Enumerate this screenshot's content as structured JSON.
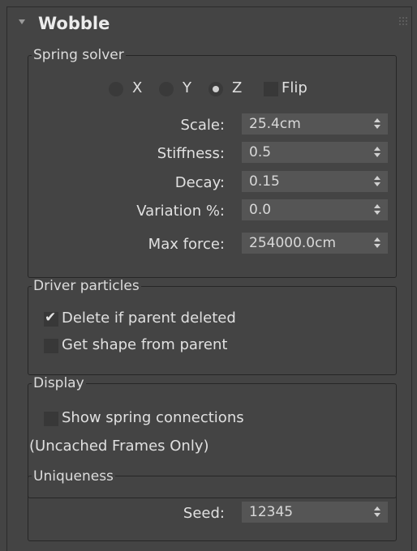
{
  "rollout": {
    "title": "Wobble"
  },
  "spring_solver": {
    "label": "Spring solver",
    "axes": [
      {
        "label": "X",
        "selected": false
      },
      {
        "label": "Y",
        "selected": false
      },
      {
        "label": "Z",
        "selected": true
      }
    ],
    "flip": {
      "label": "Flip",
      "checked": false
    },
    "fields": [
      {
        "label": "Scale:",
        "value": "25.4cm"
      },
      {
        "label": "Stiffness:",
        "value": "0.5"
      },
      {
        "label": "Decay:",
        "value": "0.15"
      },
      {
        "label": "Variation %:",
        "value": "0.0"
      },
      {
        "label": "Max force:",
        "value": "254000.0cm"
      }
    ]
  },
  "driver_particles": {
    "label": "Driver particles",
    "delete_if_parent_deleted": {
      "label": "Delete if parent deleted",
      "checked": true
    },
    "get_shape_from_parent": {
      "label": "Get shape from parent",
      "checked": false
    }
  },
  "display": {
    "label": "Display",
    "show_spring_connections": {
      "label": "Show spring connections",
      "checked": false
    },
    "note": "(Uncached Frames Only)"
  },
  "uniqueness": {
    "label": "Uniqueness",
    "seed": {
      "label": "Seed:",
      "value": "12345"
    }
  },
  "colors": {
    "background": "#444444",
    "field": "#555555",
    "checkbox": "#383838",
    "text": "#dcdcdc",
    "group_border": "#262626"
  },
  "icons": [
    "collapse-arrow-icon",
    "grip-icon",
    "spinner-arrows-icon",
    "checkmark-icon"
  ]
}
